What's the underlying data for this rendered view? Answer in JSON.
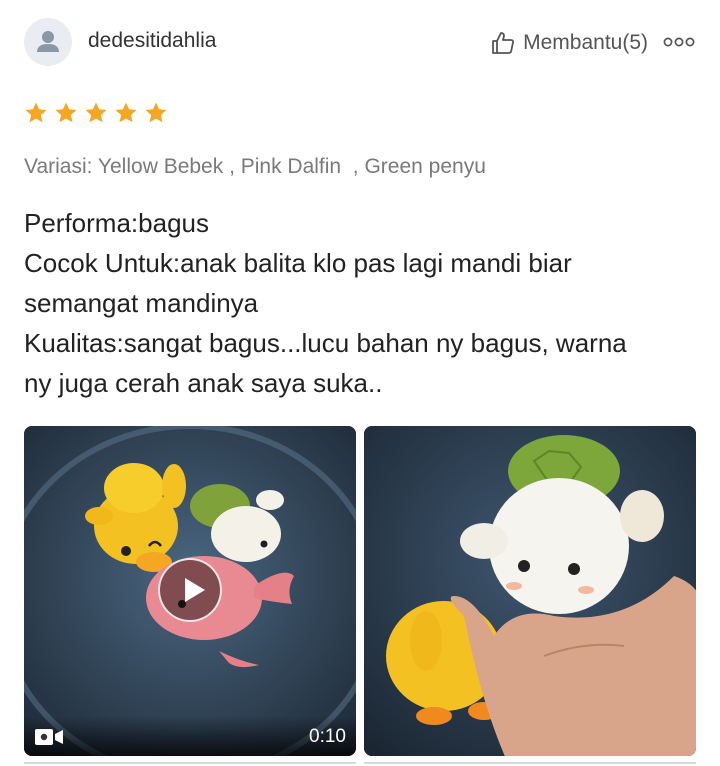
{
  "review": {
    "username": "dedesitidahlia",
    "helpful_label": "Membantu(5)",
    "rating": 5,
    "rating_max": 5,
    "variation": "Variasi: Yellow Bebek , Pink Dalfin  , Green penyu",
    "body_lines": [
      "Performa:bagus",
      "Cocok Untuk:anak balita klo pas lagi mandi biar",
      "semangat mandinya",
      "Kualitas:sangat bagus...lucu bahan ny bagus, warna",
      "ny juga cerah anak saya suka.."
    ]
  },
  "media": {
    "video": {
      "duration": "0:10"
    }
  },
  "icons": {
    "avatar": "person-icon",
    "helpful": "thumbs-up-icon",
    "more": "more-options-icon",
    "star": "star-icon",
    "video": "video-camera-icon",
    "play": "play-icon"
  },
  "colors": {
    "star": "#f5a623",
    "text": "#222222",
    "muted": "#7a7a7a",
    "avatar_bg": "#e9edf1",
    "avatar_fg": "#8a97a5"
  }
}
